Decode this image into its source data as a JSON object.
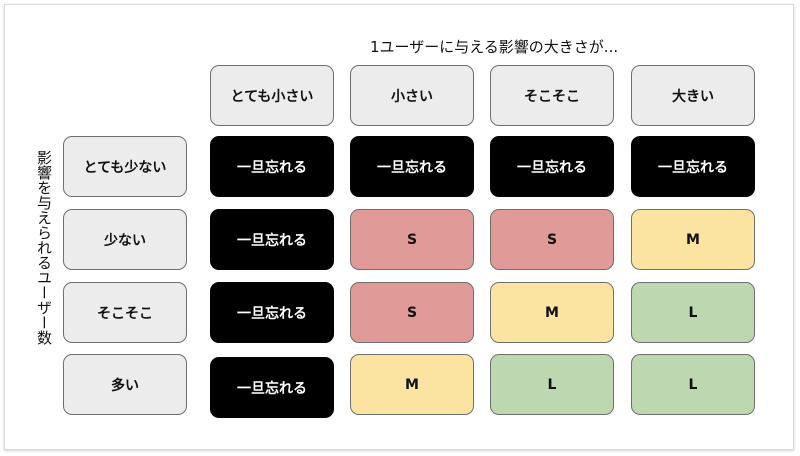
{
  "top_label": "1ユーザーに与える影響の大きさが...",
  "side_label": "影響を与えられるユーザー数",
  "columns": [
    "とても小さい",
    "小さい",
    "そこそこ",
    "大きい"
  ],
  "rows": [
    "とても少ない",
    "少ない",
    "そこそこ",
    "多い"
  ],
  "cells": [
    [
      "一旦忘れる",
      "一旦忘れる",
      "一旦忘れる",
      "一旦忘れる"
    ],
    [
      "一旦忘れる",
      "S",
      "S",
      "M"
    ],
    [
      "一旦忘れる",
      "S",
      "M",
      "L"
    ],
    [
      "一旦忘れる",
      "M",
      "L",
      "L"
    ]
  ],
  "colors": {
    "ignore": "#000000",
    "S": "#e09b99",
    "M": "#fbe4a1",
    "L": "#bdd8b1",
    "header": "#ececec"
  }
}
